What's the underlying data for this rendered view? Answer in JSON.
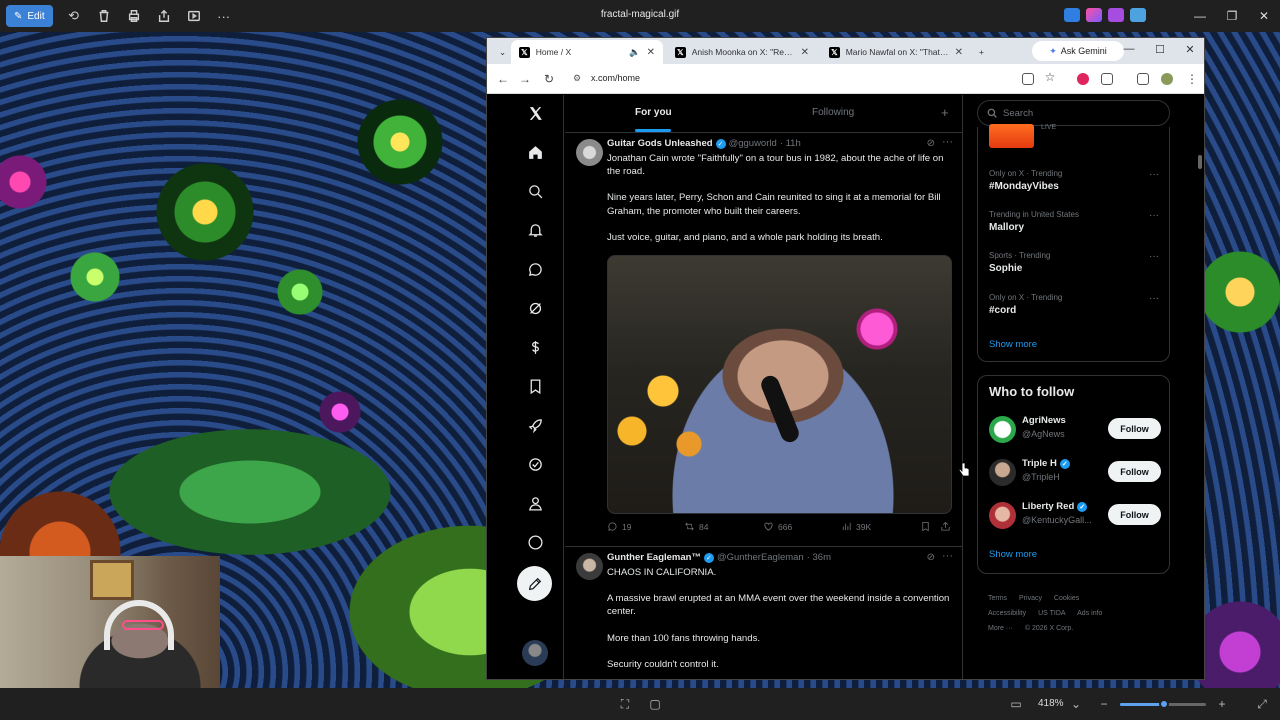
{
  "viewer": {
    "edit_label": "Edit",
    "file_name": "fractal-magical.gif",
    "zoom": "418%"
  },
  "browser": {
    "tabs": [
      {
        "title": "Home / X",
        "active": true
      },
      {
        "title": "Anish Moonka on X: \"Researc",
        "active": false
      },
      {
        "title": "Mario Nawfal on X: \"That's th",
        "active": false
      }
    ],
    "ask_gemini": "Ask Gemini",
    "url": "x.com/home"
  },
  "feed": {
    "tab_for_you": "For you",
    "tab_following": "Following",
    "posts": [
      {
        "name": "Guitar Gods Unleashed",
        "handle": "@gguworld",
        "time": "· 11h",
        "text": [
          "Jonathan Cain wrote \"Faithfully\" on a tour bus in 1982, about the ache of life on the road.",
          "Nine years later, Perry, Schon and Cain reunited to sing it at a memorial for Bill Graham, the promoter who built their careers.",
          "Just voice, guitar, and piano, and a whole park holding its breath."
        ],
        "replies": "19",
        "reposts": "84",
        "likes": "666",
        "views": "39K"
      },
      {
        "name": "Gunther Eagleman™",
        "handle": "@GuntherEagleman",
        "time": "· 36m",
        "text": [
          "CHAOS IN CALIFORNIA.",
          "A massive brawl erupted at an MMA event over the weekend inside a convention center.",
          "More than 100 fans throwing hands.",
          "Security couldn't control it."
        ]
      }
    ]
  },
  "sidebar": {
    "search_placeholder": "Search",
    "live_label": "LIVE",
    "trends": [
      {
        "meta": "Only on X · Trending",
        "name": "#MondayVibes"
      },
      {
        "meta": "Trending in United States",
        "name": "Mallory"
      },
      {
        "meta": "Sports · Trending",
        "name": "Sophie"
      },
      {
        "meta": "Only on X · Trending",
        "name": "#cord"
      }
    ],
    "show_more": "Show more",
    "who_to_follow": {
      "title": "Who to follow",
      "accounts": [
        {
          "name": "AgriNews",
          "handle": "@AgNews",
          "follow": "Follow"
        },
        {
          "name": "Triple H",
          "handle": "@TripleH",
          "follow": "Follow"
        },
        {
          "name": "Liberty Red",
          "handle": "@KentuckyGall...",
          "follow": "Follow"
        }
      ],
      "show_more": "Show more"
    },
    "footer": [
      "Terms",
      "Privacy",
      "Cookies",
      "Accessibility",
      "US TIDA",
      "Ads info",
      "More ···",
      "© 2026 X Corp."
    ]
  },
  "colors": {
    "accent": "#1d9bf0",
    "viewer_edit": "#3b82d6",
    "background": "#000000"
  }
}
